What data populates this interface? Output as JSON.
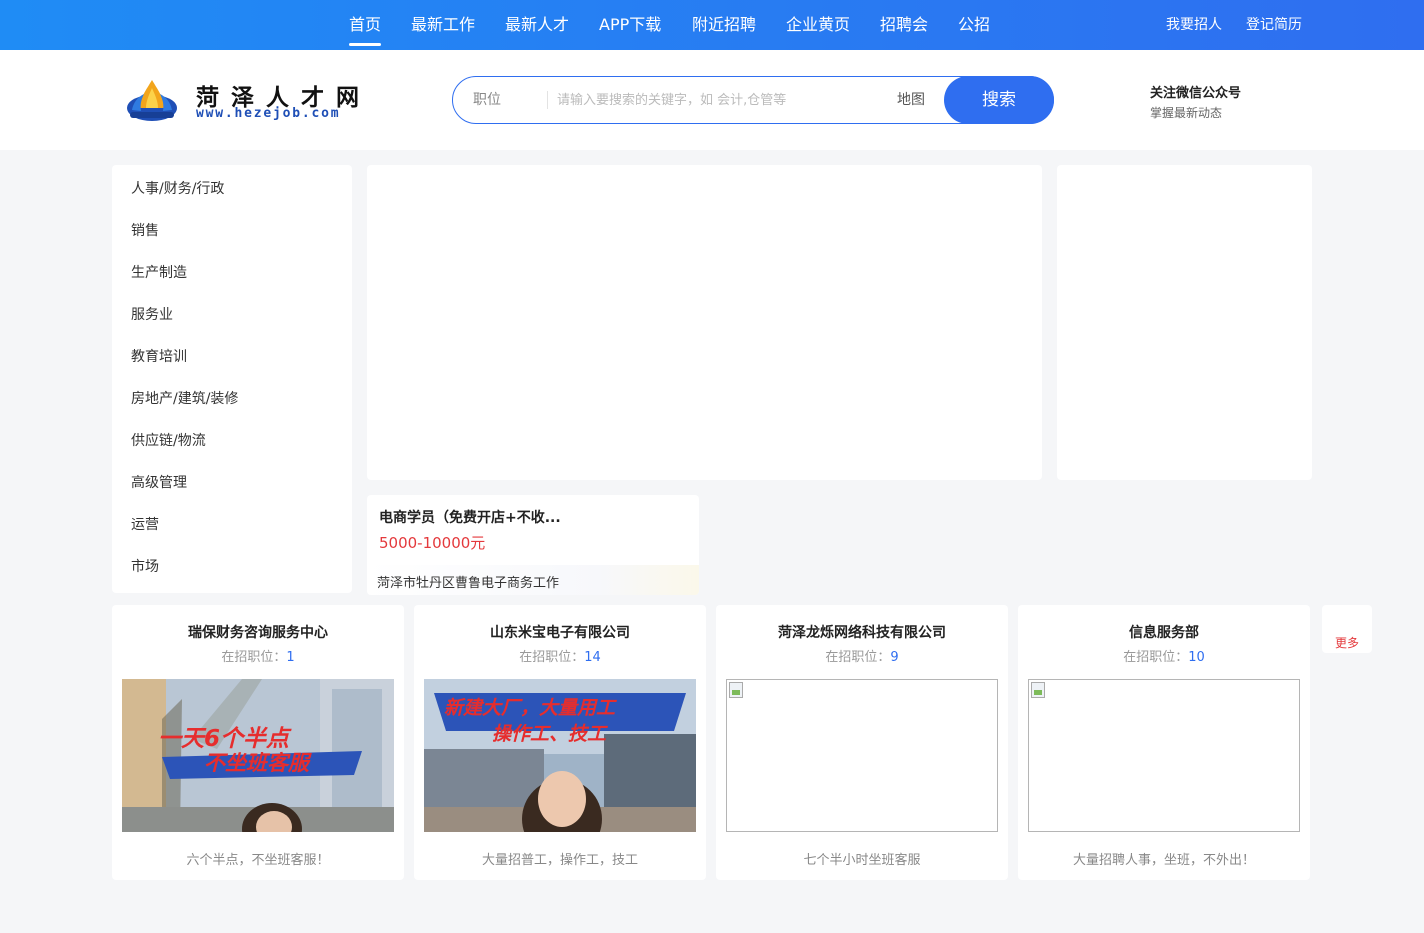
{
  "nav": {
    "items": [
      "首页",
      "最新工作",
      "最新人才",
      "APP下载",
      "附近招聘",
      "企业黄页",
      "招聘会",
      "公招"
    ],
    "right": [
      "我要招人",
      "登记简历"
    ]
  },
  "logo": {
    "title": "菏泽人才网",
    "url": "www.hezejob.com"
  },
  "search": {
    "category": "职位",
    "placeholder": "请输入要搜索的关键字，如 会计,仓管等",
    "map_label": "地图",
    "button": "搜索"
  },
  "wechat": {
    "title": "关注微信公众号",
    "subtitle": "掌握最新动态"
  },
  "categories": [
    "人事/财务/行政",
    "销售",
    "生产制造",
    "服务业",
    "教育培训",
    "房地产/建筑/装修",
    "供应链/物流",
    "高级管理",
    "运营",
    "市场"
  ],
  "job": {
    "title": "电商学员（免费开店+不收...",
    "salary": "5000-10000元",
    "location": "菏泽市牡丹区曹鲁电子商务工作"
  },
  "companies": [
    {
      "name": "瑞保财务咨询服务中心",
      "positions_label": "在招职位：",
      "positions": "1",
      "image": "video",
      "overlay": [
        "一天6个半点",
        "不坐班客服"
      ],
      "desc": "六个半点，不坐班客服！"
    },
    {
      "name": "山东米宝电子有限公司",
      "positions_label": "在招职位：",
      "positions": "14",
      "image": "video",
      "overlay": [
        "新建大厂，大量用工",
        "操作工、技工"
      ],
      "desc": "大量招普工，操作工，技工"
    },
    {
      "name": "菏泽龙烁网络科技有限公司",
      "positions_label": "在招职位：",
      "positions": "9",
      "image": "broken",
      "desc": "七个半小时坐班客服"
    },
    {
      "name": "信息服务部",
      "positions_label": "在招职位：",
      "positions": "10",
      "image": "broken",
      "desc": "大量招聘人事，坐班，不外出！"
    }
  ],
  "more": "更多",
  "colors": {
    "primary": "#2f6ef0",
    "salary": "#e4393c",
    "count": "#2f6ef0"
  }
}
